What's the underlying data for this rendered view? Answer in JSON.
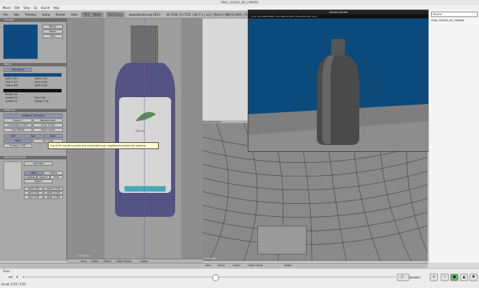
{
  "window": {
    "title": "FINAL_RUSSIA_DE_CAMARA"
  },
  "menubar": [
    "Movie",
    "Edit",
    "View",
    "Go",
    "Sound",
    "Help"
  ],
  "blender_header": {
    "menus": [
      "File",
      "Add",
      "Timeline",
      "Game",
      "Render",
      "Help"
    ],
    "screen": "SR:2 - Model",
    "scene": "SCE:Scene",
    "site": "www.blender.org 249.1",
    "stats": "Ve:7208 | Fa:7151 | Ob:7-1 | La:1 | Mem:2.38M (0.43M) | Time:"
  },
  "left_panel": {
    "preview_title": "Preview",
    "preview_buttons": [
      "Blend",
      "Paper",
      "Real"
    ],
    "world_title": "World",
    "world_name": "WO:World",
    "horizon": [
      "HoR 0.057",
      "HoG 0.217",
      "HoB 0.439"
    ],
    "zenith": [
      "ZeR 0.100",
      "ZeG 0.100",
      "ZeB 0.100"
    ],
    "ambient": [
      "AmbR 0.0",
      "AmbG 0.0",
      "AmbB 0.0"
    ],
    "exposure": [
      "Exp 0.00",
      "Range 1.00"
    ],
    "amb_occ_title": "Amb Occ",
    "ambient_occlusion_label": "Ambient Occlusion",
    "ao_row1": [
      "Passes 7",
      "Approximate"
    ],
    "ao_row2": [
      "Correction 1.000",
      "Error 0.250"
    ],
    "ao_row3": [
      "Use Falloff",
      "Pixel Cache"
    ],
    "ao_buttons": [
      "Add",
      "Sub",
      "Both"
    ],
    "ao_buttons2": [
      "Plain",
      "Sky Color"
    ],
    "energy": "Energy 1.000",
    "texture_title": "Texture and Input",
    "texture_add": "Add New",
    "texture_tabs": [
      "View",
      "Global"
    ],
    "texture_tabs2": [
      "AngMap",
      "Sphere",
      "Tube"
    ],
    "object": "Object:",
    "offsets": [
      "ofsX 0.00",
      "ofsY 0.00",
      "ofsZ 0.00"
    ],
    "sizes": [
      "sizeX 1.000",
      "sizeY 1.000",
      "sizeZ 1.000"
    ]
  },
  "viewport": {
    "bottle_label": "Whisky",
    "footer": [
      "View",
      "Select",
      "Object",
      "Object Mode",
      "Global"
    ],
    "frame": "(17) bottle"
  },
  "tooltip": "Cache AO results in pixels and interpolate over neighbouring pixels for speedup",
  "render_window": {
    "title": "Blender:Render",
    "info": "Fra:1 | Ve:7208 Fa:6877 La:1 Mem:2.52M | Time:00:03.39 | Sce:..."
  },
  "viewport3": {
    "header": [
      "View",
      "Select",
      "Object"
    ],
    "footer": [
      "View",
      "Select",
      "Object",
      "Object Mode",
      "Global"
    ],
    "frame": "(17) bottle"
  },
  "right_panel": {
    "dropdown": "Playlist",
    "item": "FINAL_RUSSIA_DE_CAMARA"
  },
  "timeline": {
    "label": "Time",
    "counter": "Scrub:",
    "time": "3:55 / 3:55",
    "speaker": "Speaker"
  }
}
